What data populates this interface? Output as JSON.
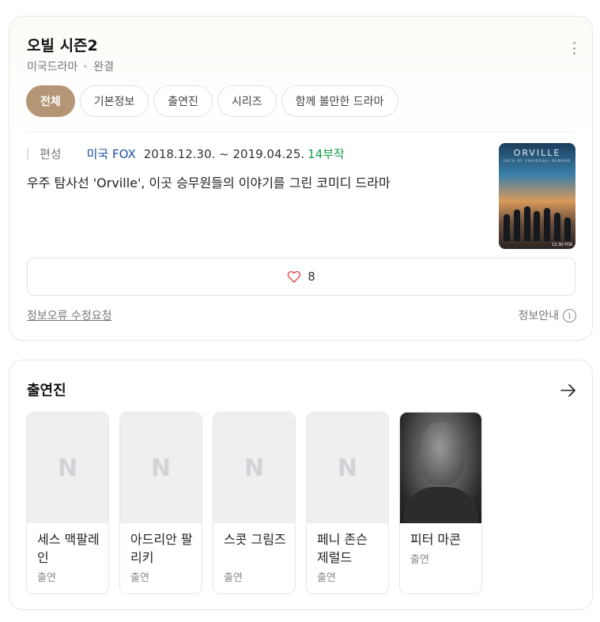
{
  "program": {
    "title": "오빌 시즌2",
    "genre": "미국드라마",
    "status": "완결"
  },
  "tabs": [
    {
      "label": "전체",
      "active": true
    },
    {
      "label": "기본정보",
      "active": false
    },
    {
      "label": "출연진",
      "active": false
    },
    {
      "label": "시리즈",
      "active": false
    },
    {
      "label": "함께 볼만한 드라마",
      "active": false
    }
  ],
  "broadcast": {
    "label": "편성",
    "network": "미국 FOX",
    "dates": "2018.12.30. ~ 2019.04.25.",
    "episodes": "14부작"
  },
  "description": "우주 탐사선 'Orville', 이곳 승무원들의 이야기를 그린 코미디 드라마",
  "poster": {
    "title": "ORVILLE",
    "subtitle": "EACH OF UNIVERSAL DEMAND",
    "tag": "12.30 FOX"
  },
  "like": {
    "count": "8",
    "icon": "heart-icon",
    "color": "#e14d4d"
  },
  "footer": {
    "report": "정보오류 수정요청",
    "guide": "정보안내",
    "guide_icon": "i"
  },
  "cast": {
    "title": "출연진",
    "arrow_icon": "arrow-right-icon",
    "placeholder_logo": "N",
    "members": [
      {
        "name": "세스 맥팔레인",
        "role": "출연",
        "has_photo": false
      },
      {
        "name": "아드리안 팔리키",
        "role": "출연",
        "has_photo": false
      },
      {
        "name": "스콧 그림즈",
        "role": "출연",
        "has_photo": false
      },
      {
        "name": "페니 존슨 제럴드",
        "role": "출연",
        "has_photo": false
      },
      {
        "name": "피터 마콘",
        "role": "출연",
        "has_photo": true
      }
    ]
  },
  "colors": {
    "accent": "#b49677",
    "network_link": "#1a4fa0",
    "episodes": "#139e4a"
  }
}
